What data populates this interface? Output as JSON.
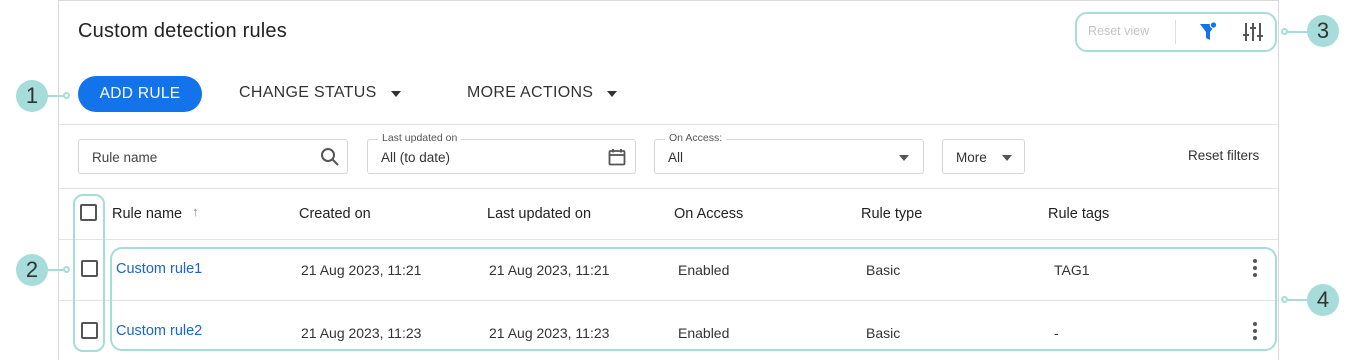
{
  "page": {
    "title": "Custom detection rules"
  },
  "toolbar": {
    "reset_view": "Reset view",
    "filter_icon": "filter-icon",
    "tune_icon": "tune-icon"
  },
  "actions": {
    "add_rule": "ADD RULE",
    "change_status": "CHANGE STATUS",
    "more_actions": "MORE ACTIONS"
  },
  "filters": {
    "rule_name_placeholder": "Rule name",
    "last_updated_label": "Last updated on",
    "last_updated_value": "All (to date)",
    "on_access_label": "On Access:",
    "on_access_value": "All",
    "more": "More",
    "reset_filters": "Reset filters"
  },
  "table": {
    "columns": [
      "Rule name",
      "Created on",
      "Last updated on",
      "On Access",
      "Rule type",
      "Rule tags"
    ],
    "sort_indicator": "↑",
    "rows": [
      {
        "name": "Custom rule1",
        "created": "21 Aug 2023, 11:21",
        "updated": "21 Aug 2023, 11:21",
        "on_access": "Enabled",
        "type": "Basic",
        "tags": "TAG1"
      },
      {
        "name": "Custom rule2",
        "created": "21 Aug 2023, 11:23",
        "updated": "21 Aug 2023, 11:23",
        "on_access": "Enabled",
        "type": "Basic",
        "tags": "-"
      }
    ]
  },
  "callouts": [
    "1",
    "2",
    "3",
    "4"
  ],
  "colors": {
    "accent": "#1273eb",
    "link": "#1a63d6",
    "callout": "#a6dcda"
  }
}
